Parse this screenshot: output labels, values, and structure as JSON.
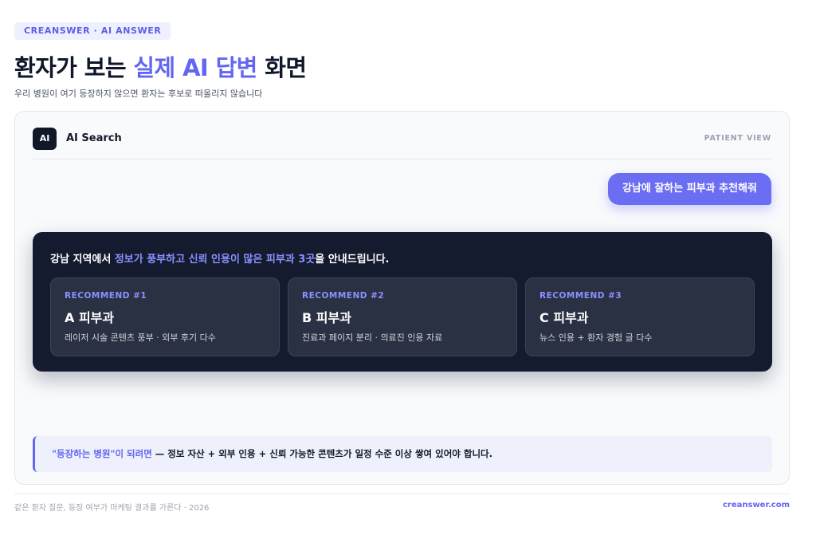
{
  "eyebrow": "CREANSWER · AI ANSWER",
  "title": {
    "prefix": "환자가 보는 ",
    "accent": "실제 AI 답변",
    "suffix": " 화면"
  },
  "subtitle": "우리 병원이 여기 등장하지 않으면 환자는 후보로 떠올리지 않습니다",
  "ai_panel": {
    "logo": "AI",
    "name": "AI Search",
    "view_label": "PATIENT VIEW",
    "query": "강남에 잘하는 피부과 추천해줘",
    "answer": {
      "prefix": "강남 지역에서 ",
      "highlight": "정보가 풍부하고 신뢰 인용이 많은 피부과 3곳",
      "suffix": "을 안내드립니다.",
      "recommendations": [
        {
          "label": "RECOMMEND #1",
          "name": "A 피부과",
          "desc": "레이저 시술 콘텐츠 풍부 · 외부 후기 다수"
        },
        {
          "label": "RECOMMEND #2",
          "name": "B 피부과",
          "desc": "진료과 페이지 분리 · 의료진 인용 자료"
        },
        {
          "label": "RECOMMEND #3",
          "name": "C 피부과",
          "desc": "뉴스 인용 + 환자 경험 글 다수"
        }
      ]
    },
    "note": {
      "highlight": "\"등장하는 병원\"이 되려면",
      "text": " — 정보 자산 + 외부 인용 + 신뢰 가능한 콘텐츠가 일정 수준 이상 쌓여 있어야 합니다."
    }
  },
  "footer": {
    "left": "같은 환자 질문, 등장 여부가 마케팅 결과를 가른다 · 2026",
    "right": "creanswer.com"
  },
  "colors": {
    "accent": "#6366f1",
    "dark_panel": "#141b2e",
    "query_bubble": "#6b6df2"
  }
}
